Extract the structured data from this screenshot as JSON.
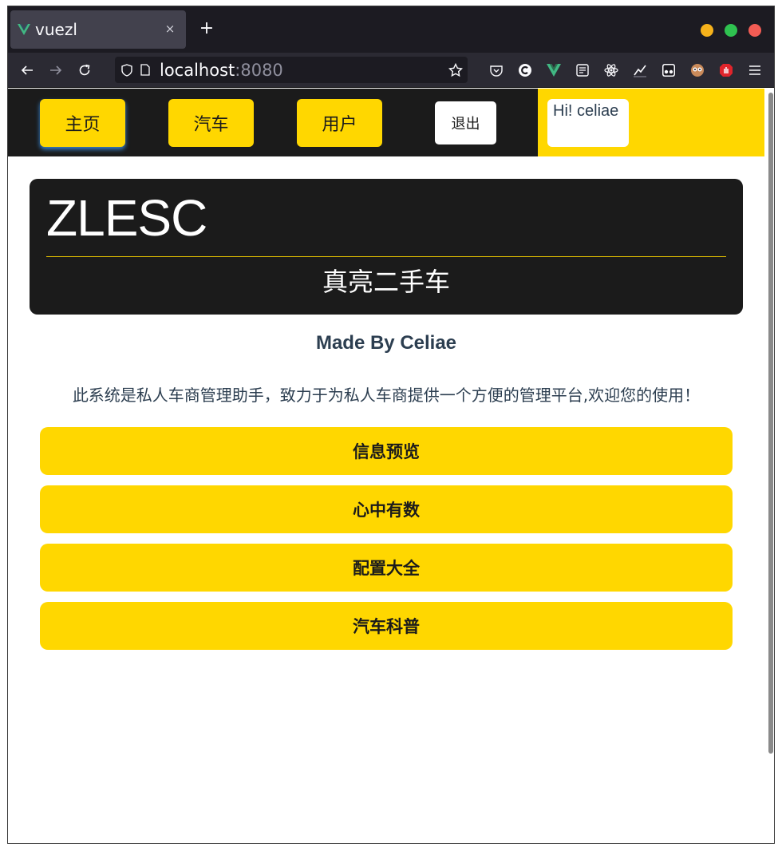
{
  "browser": {
    "tab_title": "vuezl",
    "tab_close": "×",
    "new_tab": "+",
    "url_host": "localhost",
    "url_port": ":8080",
    "window_controls": {
      "minimize_color": "#f6b21b",
      "maximize_color": "#2fc250",
      "close_color": "#f25c54"
    }
  },
  "app": {
    "nav": {
      "items": [
        {
          "label": "主页",
          "active": true
        },
        {
          "label": "汽车",
          "active": false
        },
        {
          "label": "用户",
          "active": false
        }
      ],
      "logout_label": "退出",
      "greeting": "Hi! celiae"
    },
    "hero": {
      "title": "ZLESC",
      "subtitle": "真亮二手车"
    },
    "made_by": "Made By Celiae",
    "intro": "此系统是私人车商管理助手，致力于为私人车商提供一个方便的管理平台,欢迎您的使用！",
    "features": [
      {
        "label": "信息预览"
      },
      {
        "label": "心中有数"
      },
      {
        "label": "配置大全"
      },
      {
        "label": "汽车科普"
      }
    ],
    "colors": {
      "accent": "#ffd700",
      "dark": "#1b1b1b",
      "text": "#2c3e50"
    }
  }
}
